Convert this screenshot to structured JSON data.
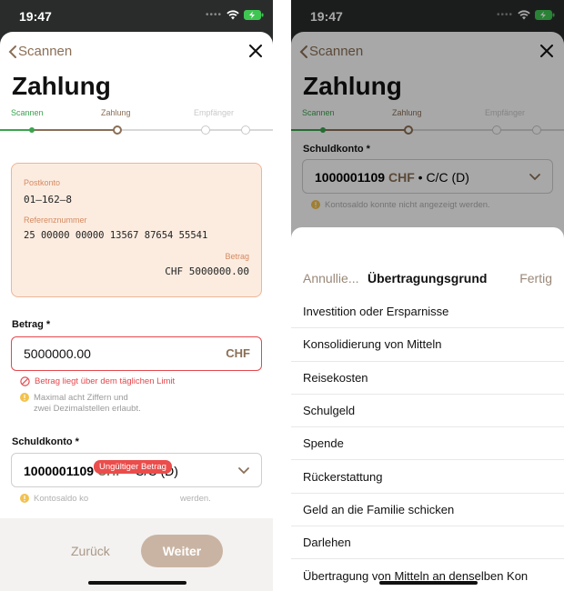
{
  "status_bar": {
    "time": "19:47"
  },
  "nav": {
    "back_label": "Scannen"
  },
  "page": {
    "title": "Zahlung"
  },
  "stepper": {
    "steps": [
      "Scannen",
      "Zahlung",
      "Empfänger"
    ],
    "colors": {
      "done": "#3aa34e",
      "active": "#8a6f56",
      "todo": "#c9c9c9"
    }
  },
  "qr_card": {
    "postkonto_label": "Postkonto",
    "postkonto_value": "01–162–8",
    "ref_label": "Referenznummer",
    "ref_value": "25 00000 00000 13567 87654 55541",
    "amount_label": "Betrag",
    "amount_value": "CHF 5000000.00"
  },
  "amount": {
    "label": "Betrag *",
    "value": "5000000.00",
    "currency": "CHF",
    "error": "Betrag liegt über dem täglichen Limit",
    "info_line1": "Maximal acht Ziffern und",
    "info_line2": "zwei Dezimalstellen erlaubt."
  },
  "account": {
    "label": "Schuldkonto *",
    "number": "1000001109",
    "currency": "CHF",
    "type": "• C/C (D)",
    "info": "Kontosaldo konnte nicht angezeigt werden.",
    "info_left": "Kontosaldo ko",
    "info_right": "werden."
  },
  "tooltip": {
    "text": "Ungültiger Betrag"
  },
  "footer": {
    "back_label": "Zurück",
    "next_label": "Weiter"
  },
  "picker": {
    "cancel_label": "Annullie...",
    "title": "Übertragungsgrund",
    "done_label": "Fertig",
    "options": [
      "Investition oder Ersparnisse",
      "Konsolidierung von Mitteln",
      "Reisekosten",
      "Schulgeld",
      "Spende",
      "Rückerstattung",
      "Geld an die Familie schicken",
      "Darlehen",
      "Übertragung von Mitteln an denselben Kon"
    ]
  },
  "colors": {
    "accent": "#8a6f56",
    "error": "#e5484d",
    "warning": "#f2c14e",
    "card_bg": "#fcece0",
    "card_border": "#eeb596"
  }
}
